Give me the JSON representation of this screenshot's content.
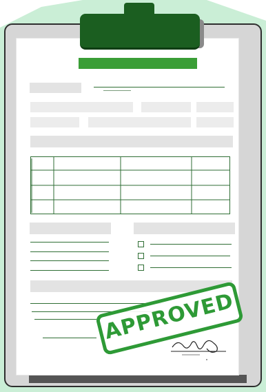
{
  "stamp": {
    "text": "APPROVED"
  },
  "colors": {
    "accent_green": "#3a9e36",
    "dark_green": "#1b5e20",
    "stamp_green": "#2e9a36",
    "background_blob": "#9fe0b4",
    "paper": "#ffffff",
    "clipboard": "#d6d6d6"
  },
  "form": {
    "table": {
      "rows": 3,
      "columns": 4
    },
    "checklist": {
      "items": 3,
      "checked": [
        false,
        false,
        false
      ]
    }
  }
}
